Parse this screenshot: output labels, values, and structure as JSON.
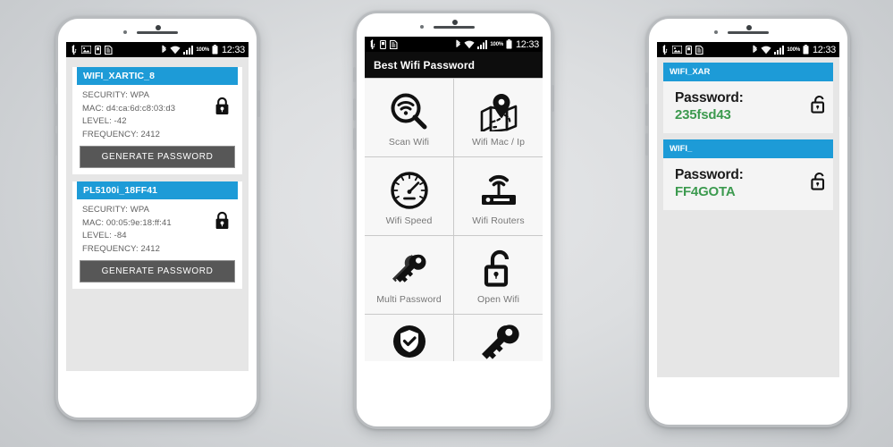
{
  "theme": {
    "accent_blue": "#1d9bd7",
    "password_green": "#3c9a4f",
    "button_gray": "#575757",
    "statusbar_black": "#000000",
    "appbar_black": "#0d0d0d",
    "screen_bg": "#e6e6e6"
  },
  "statusbar": {
    "battery_percent": "100%",
    "time": "12:33",
    "left_icons": [
      "usb-icon",
      "screenshot-icon",
      "sim-card-icon",
      "document-icon"
    ],
    "right_icons": [
      "bluetooth-icon",
      "wifi-icon",
      "signal-bars-icon",
      "battery-icon"
    ]
  },
  "phone1": {
    "networks": [
      {
        "ssid": "WIFI_XARTIC_8",
        "security": "SECURITY: WPA",
        "mac": "MAC: d4:ca:6d:c8:03:d3",
        "level": "LEVEL: -42",
        "frequency": "FREQUENCY: 2412",
        "lock_icon": "lock-closed-icon",
        "button_label": "GENERATE PASSWORD"
      },
      {
        "ssid": "PL5100i_18FF41",
        "security": "SECURITY: WPA",
        "mac": "MAC: 00:05:9e:18:ff:41",
        "level": "LEVEL: -84",
        "frequency": "FREQUENCY: 2412",
        "lock_icon": "lock-closed-icon",
        "button_label": "GENERATE PASSWORD"
      }
    ]
  },
  "phone2": {
    "app_title": "Best Wifi Password",
    "menu": [
      {
        "label": "Scan Wifi",
        "icon": "wifi-search-icon"
      },
      {
        "label": "Wifi Mac / Ip",
        "icon": "map-pin-icon"
      },
      {
        "label": "Wifi Speed",
        "icon": "speedometer-icon"
      },
      {
        "label": "Wifi Routers",
        "icon": "router-icon"
      },
      {
        "label": "Multi Password",
        "icon": "keys-icon"
      },
      {
        "label": "Open Wifi",
        "icon": "lock-open-icon"
      },
      {
        "label": "",
        "icon": "shield-check-icon"
      },
      {
        "label": "",
        "icon": "key-icon"
      }
    ]
  },
  "phone3": {
    "saved": [
      {
        "ssid": "WIFI_XAR",
        "password_label": "Password:",
        "password_value": "235fsd43",
        "lock_icon": "lock-open-icon"
      },
      {
        "ssid": "WIFI_",
        "password_label": "Password:",
        "password_value": "FF4GOTA",
        "lock_icon": "lock-open-icon"
      }
    ]
  }
}
